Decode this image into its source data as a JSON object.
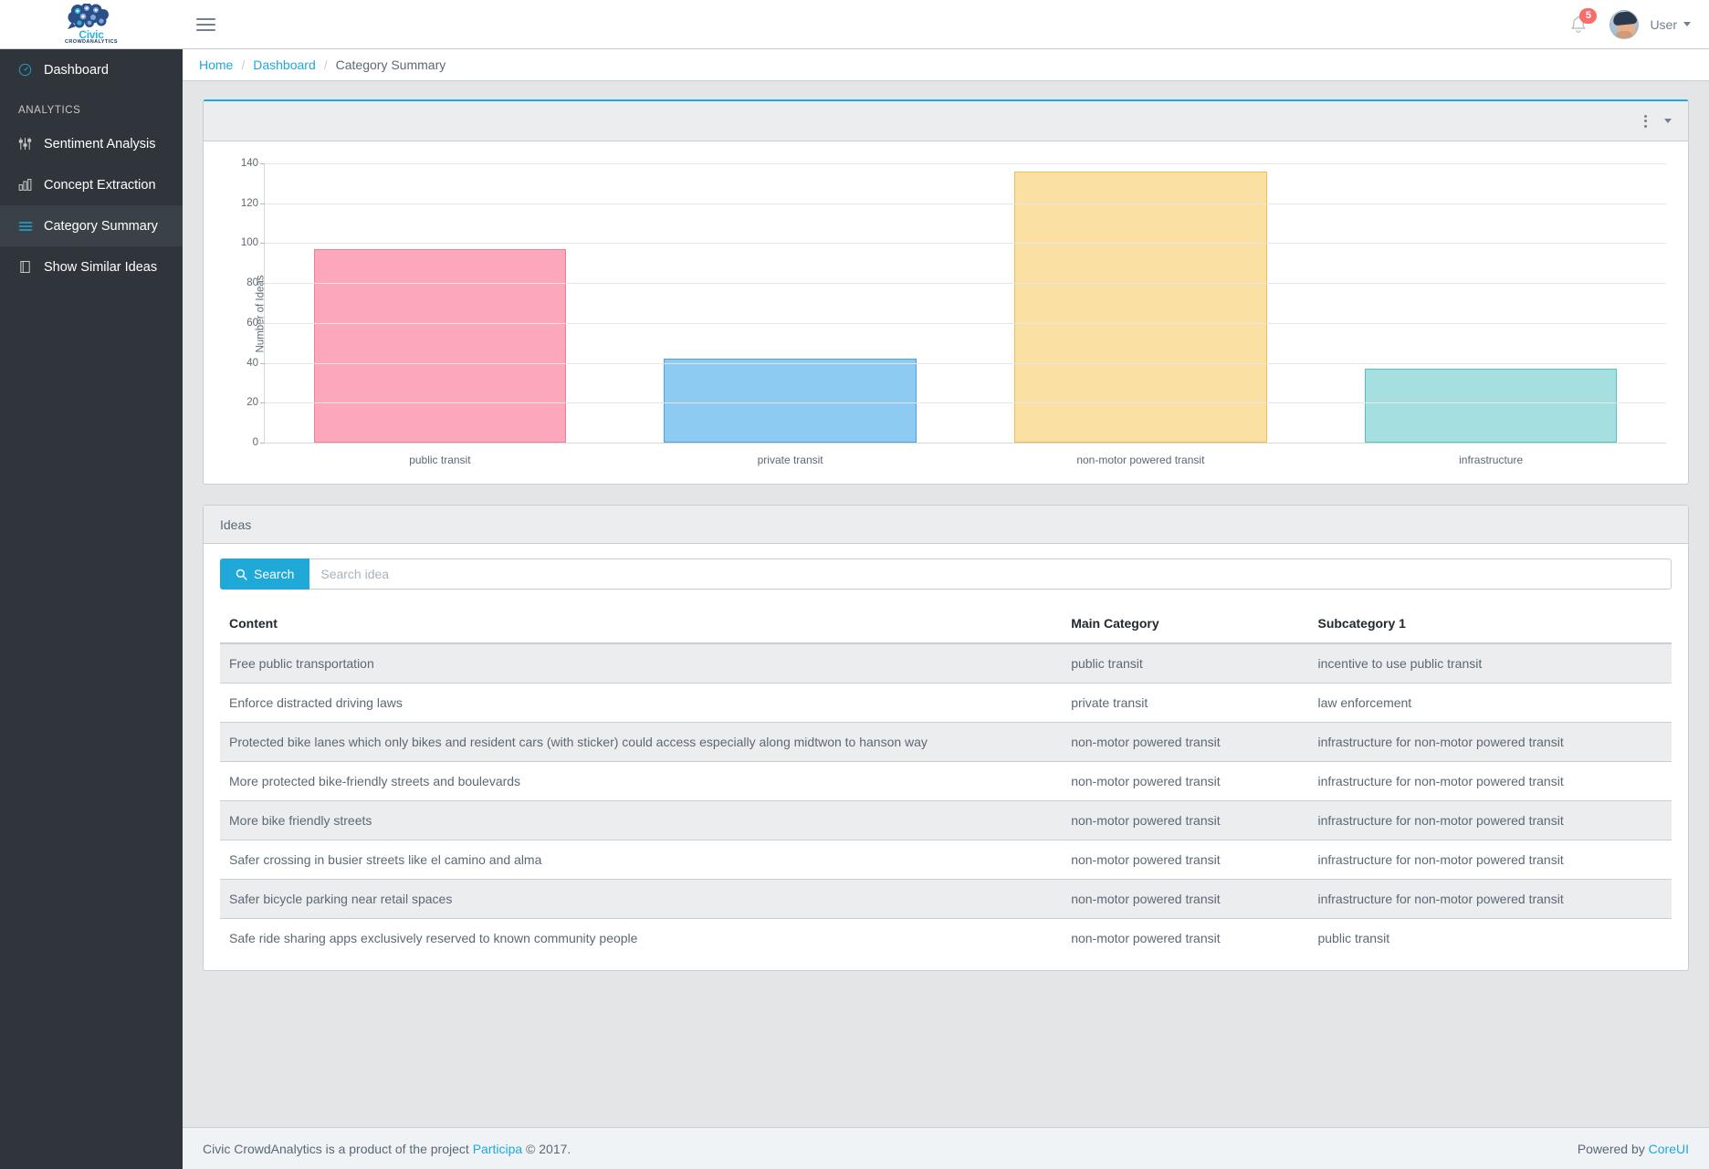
{
  "header": {
    "brand_name": "Civic",
    "brand_sub": "CROWDANALYTICS",
    "menu_icon": "hamburger-icon",
    "notification_count": "5",
    "user_label": "User"
  },
  "sidebar": {
    "items": [
      {
        "label": "Dashboard",
        "icon": "speedometer-icon",
        "active": false
      },
      {
        "label": "Sentiment Analysis",
        "icon": "sliders-icon",
        "active": false
      },
      {
        "label": "Concept Extraction",
        "icon": "bar-chart-icon",
        "active": false
      },
      {
        "label": "Category Summary",
        "icon": "list-icon",
        "active": true
      },
      {
        "label": "Show Similar Ideas",
        "icon": "book-icon",
        "active": false
      }
    ],
    "section_title": "ANALYTICS"
  },
  "breadcrumb": {
    "home": "Home",
    "dashboard": "Dashboard",
    "current": "Category Summary",
    "separator": "/"
  },
  "chart_card": {
    "menu_icon": "vertical-dots-icon",
    "caret_icon": "chevron-down-icon"
  },
  "chart_data": {
    "type": "bar",
    "title": "",
    "xlabel": "",
    "ylabel": "Number of Ideas",
    "categories": [
      "public transit",
      "private transit",
      "non-motor powered transit",
      "infrastructure"
    ],
    "values": [
      97,
      42,
      136,
      37
    ],
    "colors": [
      "#fda7bb",
      "#8ecbf2",
      "#fbe0a3",
      "#a6dfdf"
    ],
    "border_colors": [
      "#f8799a",
      "#4aa3e0",
      "#f0bd54",
      "#4ec4c4"
    ],
    "ylim": [
      0,
      140
    ],
    "yticks": [
      0,
      20,
      40,
      60,
      80,
      100,
      120,
      140
    ],
    "grid": true,
    "legend": "none"
  },
  "ideas_card": {
    "title": "Ideas",
    "search_button_label": "Search",
    "search_icon": "search-icon",
    "search_placeholder": "Search idea",
    "search_value": "",
    "columns": [
      "Content",
      "Main Category",
      "Subcategory 1"
    ],
    "rows": [
      {
        "content": "Free public transportation",
        "main_category": "public transit",
        "subcategory": "incentive to use public transit"
      },
      {
        "content": "Enforce distracted driving laws",
        "main_category": "private transit",
        "subcategory": "law enforcement"
      },
      {
        "content": "Protected bike lanes which only bikes and resident cars (with sticker) could access especially along midtwon to hanson way",
        "main_category": "non-motor powered transit",
        "subcategory": "infrastructure for non-motor powered transit"
      },
      {
        "content": "More protected bike-friendly streets and boulevards",
        "main_category": "non-motor powered transit",
        "subcategory": "infrastructure for non-motor powered transit"
      },
      {
        "content": "More bike friendly streets",
        "main_category": "non-motor powered transit",
        "subcategory": "infrastructure for non-motor powered transit"
      },
      {
        "content": "Safer crossing in busier streets like el camino and alma",
        "main_category": "non-motor powered transit",
        "subcategory": "infrastructure for non-motor powered transit"
      },
      {
        "content": "Safer bicycle parking near retail spaces",
        "main_category": "non-motor powered transit",
        "subcategory": "infrastructure for non-motor powered transit"
      },
      {
        "content": "Safe ride sharing apps exclusively reserved to known community people",
        "main_category": "non-motor powered transit",
        "subcategory": "public transit"
      }
    ]
  },
  "footer": {
    "text_before": "Civic CrowdAnalytics is a product of the project",
    "project_link": "Participa",
    "text_after": "© 2017.",
    "powered_by": "Powered by",
    "powered_link": "CoreUI"
  },
  "colors": {
    "accent": "#20a8d8",
    "sidebar_bg": "#2f353a",
    "sidebar_active": "#3a4248",
    "badge": "#f86c6b",
    "page_bg": "#e4e5e6"
  }
}
